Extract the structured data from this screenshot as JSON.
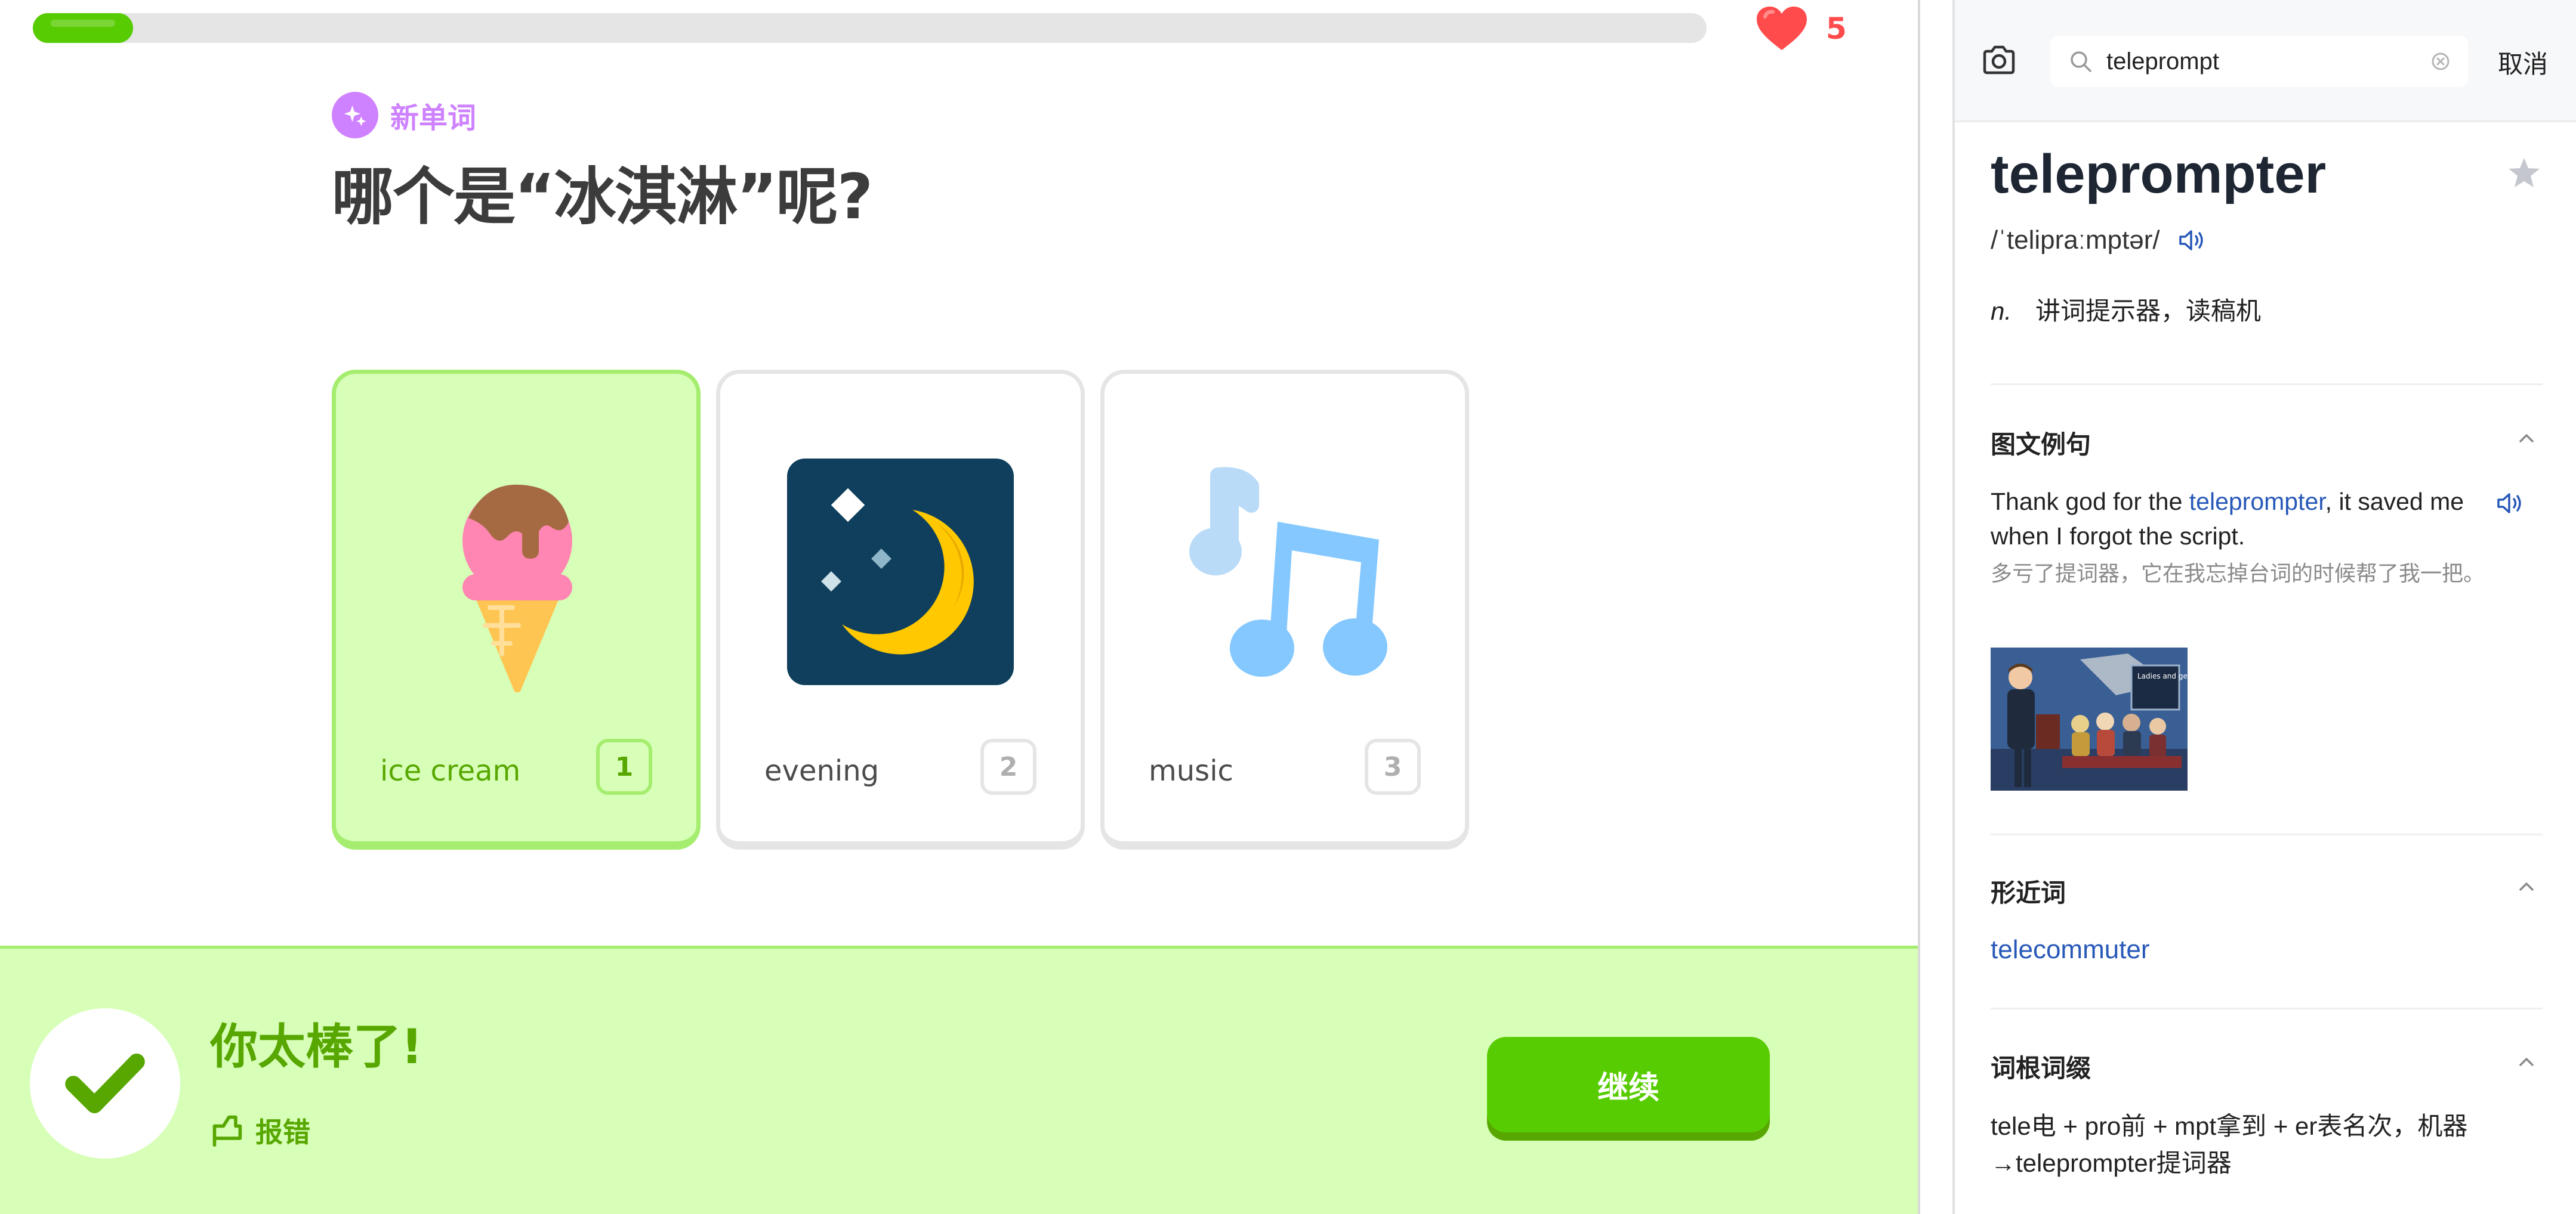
{
  "lesson": {
    "progress": 0.06,
    "hearts": "5",
    "badge": "新单词",
    "question": "哪个是“冰淇淋”呢?",
    "choices": [
      {
        "word": "ice cream",
        "key": "1",
        "selected": true,
        "icon": "ice-cream-icon"
      },
      {
        "word": "evening",
        "key": "2",
        "selected": false,
        "icon": "moon-stars-icon"
      },
      {
        "word": "music",
        "key": "3",
        "selected": false,
        "icon": "music-notes-icon"
      }
    ],
    "feedback": {
      "title": "你太棒了!",
      "report": "报错",
      "continue": "继续"
    },
    "colors": {
      "green": "#58cc02",
      "dark_green": "#58a700",
      "light_green": "#d7ffb8",
      "purple": "#ce82ff",
      "red": "#ff4b4b"
    }
  },
  "dictionary": {
    "search": {
      "value": "teleprompt",
      "cancel": "取消"
    },
    "headword": "teleprompter",
    "phonetic": "/ˈtelipraːmptər/",
    "definition": {
      "pos": "n.",
      "meaning": "讲词提示器，读稿机"
    },
    "sections": {
      "examples": "图文例句",
      "similar": "形近词",
      "etymology": "词根词缀"
    },
    "example": {
      "en_before": "Thank god for the ",
      "en_highlight": "teleprompter",
      "en_after": ", it saved me when I forgot the script.",
      "zh": "多亏了提词器，它在我忘掉台词的时候帮了我一把。",
      "image_text": "Ladies and gentlemen"
    },
    "similar_words": [
      "telecommuter"
    ],
    "etymology_text": "tele电 + pro前 + mpt拿到 + er表名次，机器→teleprompter提词器",
    "colors": {
      "link": "#2758b8",
      "text": "#222222",
      "muted": "#8a8a8a"
    }
  }
}
